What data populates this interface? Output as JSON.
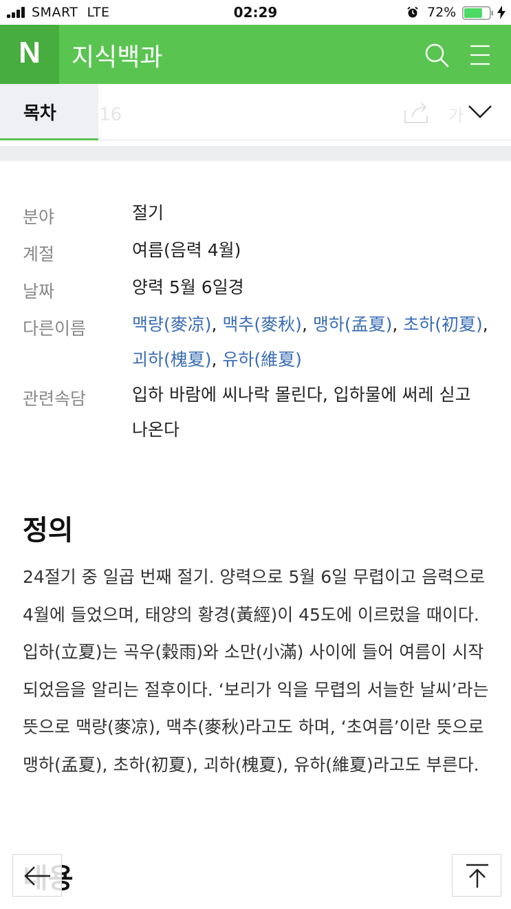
{
  "status_bar": {
    "carrier": "SMART",
    "network": "LTE",
    "time": "02:29",
    "battery": "72%",
    "battery_level": 0.72,
    "battery_color": "#4cd964"
  },
  "header": {
    "logo": "N",
    "title": "지식백과",
    "icons": [
      "search-icon",
      "menu-icon"
    ],
    "color": "#5ac451"
  },
  "toc": {
    "label": "목차",
    "ghost_text": "한 글16",
    "ghost_cut": "가"
  },
  "info": {
    "rows": [
      {
        "label": "분야",
        "value": "절기"
      },
      {
        "label": "계절",
        "value": "여름(음력 4월)"
      },
      {
        "label": "날짜",
        "value": "양력 5월 6일경"
      },
      {
        "label": "다른이름",
        "links": [
          "맥량(麥凉)",
          "맥추(麥秋)",
          "맹하(孟夏)",
          "초하(初夏)",
          "괴하(槐夏)",
          "유하(維夏)"
        ],
        "separator": ", "
      },
      {
        "label": "관련속담",
        "value": "입하 바람에 씨나락 몰린다, 입하물에 써레 싣고 나온다"
      }
    ],
    "link_color": "#3a6db5"
  },
  "definition": {
    "title": "정의",
    "text": "24절기 중 일곱 번째 절기. 양력으로 5월 6일 무렵이고 음력으로 4월에 들었으며, 태양의 황경(黃經)이 45도에 이르렀을 때이다. 입하(立夏)는 곡우(穀雨)와 소만(小滿) 사이에 들어 여름이 시작되었음을 알리는 절후이다. ‘보리가 익을 무렵의 서늘한 날씨’라는 뜻으로 맥량(麥凉), 맥추(麥秋)라고도 하며, ‘초여름’이란 뜻으로 맹하(孟夏), 초하(初夏), 괴하(槐夏), 유하(維夏)라고도 부른다."
  },
  "next_section": {
    "title": "내용"
  }
}
